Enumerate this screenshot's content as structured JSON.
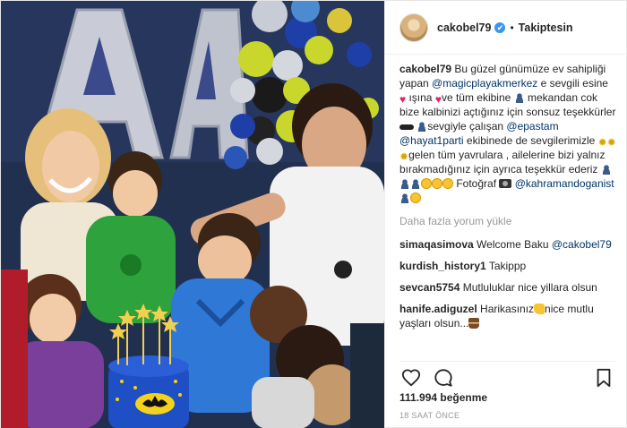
{
  "post": {
    "username": "cakobel79",
    "verified_mark": "✔",
    "dot": "•",
    "follow_label": "Takiptesin",
    "caption": {
      "user": "cakobel79",
      "t1": " Bu güzel günümüze ev sahipliği yapan ",
      "m1": "@magicplayakmerkez",
      "t2": " e sevgili esine ",
      "t3": " ışına ",
      "t4": "ve tüm ekibine",
      "t5": " mekandan cok bize kalbinizi açtığınız için sonsuz teşekkürler ",
      "t6": "sevgiyle çalışan ",
      "m2": "@epastam",
      "t7": " ",
      "m3": "@hayat1parti",
      "t8": " ekibinede de sevgilerimizle ",
      "t9": "gelen tüm yavrulara , ailelerine bizi yalnız bırakmadığınız için ayrıca teşekkür ederiz ",
      "t10": " Fotoğraf ",
      "m4": "@kahramandoganist"
    },
    "load_more": "Daha fazla yorum yükle",
    "comments": [
      {
        "user": "simaqasimova",
        "text": " Welcome Baku ",
        "mention": "@cakobel79"
      },
      {
        "user": "kurdish_history1",
        "text": " Takippp"
      },
      {
        "user": "sevcan5754",
        "text": " Mutluluklar nice yillara olsun"
      },
      {
        "user": "hanife.adiguzel",
        "text": " Harikasınız",
        "text2": "nice mutlu yaşları olsun..."
      }
    ],
    "likes": "111.994 beğenme",
    "time": "18 SAAT ÖNCE",
    "icons": {
      "heart": "heart-icon",
      "comment": "comment-icon",
      "bookmark": "bookmark-icon"
    }
  },
  "photo": {
    "description_icon": "party-photo",
    "balloon_letters": [
      "A"
    ]
  },
  "colors": {
    "mention": "#003569",
    "muted": "#999999",
    "verified": "#3897f0",
    "heart": "#e0245e"
  }
}
